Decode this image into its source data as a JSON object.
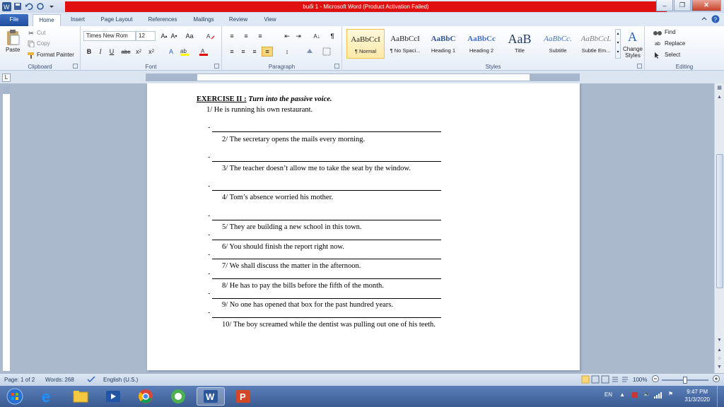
{
  "window": {
    "title": "buổi 1 - Microsoft Word (Product Activation Failed)"
  },
  "tabs": [
    "File",
    "Home",
    "Insert",
    "Page Layout",
    "References",
    "Mailings",
    "Review",
    "View"
  ],
  "clipboard": {
    "paste": "Paste",
    "cut": "Cut",
    "copy": "Copy",
    "format_painter": "Format Painter",
    "label": "Clipboard"
  },
  "font": {
    "name": "Times New Rom",
    "size": "12",
    "label": "Font"
  },
  "paragraph": {
    "label": "Paragraph"
  },
  "styles": {
    "label": "Styles",
    "items": [
      {
        "sample": "AaBbCcI",
        "name": "¶ Normal"
      },
      {
        "sample": "AaBbCcI",
        "name": "¶ No Spaci..."
      },
      {
        "sample": "AaBbC",
        "name": "Heading 1"
      },
      {
        "sample": "AaBbCc",
        "name": "Heading 2"
      },
      {
        "sample": "AaB",
        "name": "Title"
      },
      {
        "sample": "AaBbCc.",
        "name": "Subtitle"
      },
      {
        "sample": "AaBbCcL",
        "name": "Subtle Em..."
      }
    ],
    "change_styles": "Change Styles"
  },
  "editing": {
    "find": "Find",
    "replace": "Replace",
    "select": "Select",
    "label": "Editing"
  },
  "document": {
    "title_prefix": "EXERCISE II :",
    "title_rest": "Turn into the passive voice.",
    "sentences": [
      "1/ He is running his own restaurant.",
      "2/ The secretary opens the mails  every morning.",
      "3/ The teacher doesn’t allow me to take the seat by the window.",
      "4/ Tom’s  absence worried his mother.",
      "5/ They are building a new school in this town.",
      "6/ You should finish the report right now.",
      "7/ We shall discuss the matter in the afternoon.",
      "8/ He has to pay the bills before the fifth of the month.",
      "9/ No one has opened that box for the past hundred years.",
      "10/ The boy screamed while the dentist was pulling out one of his teeth."
    ],
    "dash": "-"
  },
  "statusbar": {
    "page": "Page: 1 of 2",
    "words": "Words: 268",
    "language": "English (U.S.)",
    "zoom": "100%"
  },
  "taskbar": {
    "language": "EN",
    "time": "9:47 PM",
    "date": "31/3/2020"
  }
}
